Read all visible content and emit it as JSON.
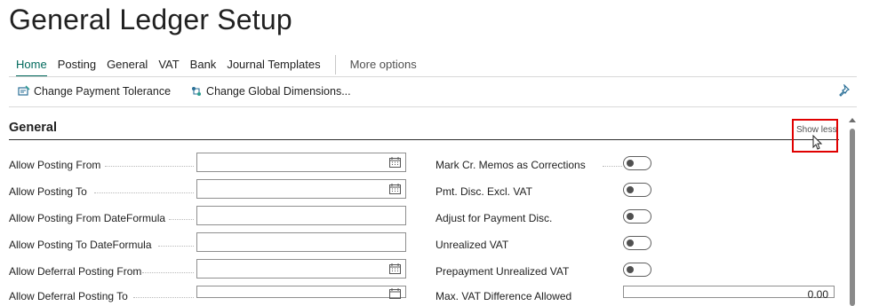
{
  "page": {
    "title": "General Ledger Setup"
  },
  "tabs": [
    {
      "label": "Home",
      "active": true
    },
    {
      "label": "Posting"
    },
    {
      "label": "General"
    },
    {
      "label": "VAT"
    },
    {
      "label": "Bank"
    },
    {
      "label": "Journal Templates"
    }
  ],
  "more_options": "More options",
  "actions": [
    {
      "label": "Change Payment Tolerance",
      "icon": "payment-tolerance-icon"
    },
    {
      "label": "Change Global Dimensions...",
      "icon": "global-dimensions-icon"
    }
  ],
  "pin_icon": "pin-icon",
  "section": {
    "title": "General",
    "toggle_label": "Show less"
  },
  "left_fields": [
    {
      "label": "Allow Posting From",
      "value": "",
      "calendar": true
    },
    {
      "label": "Allow Posting To",
      "value": "",
      "calendar": true
    },
    {
      "label": "Allow Posting From DateFormula",
      "value": "",
      "calendar": false
    },
    {
      "label": "Allow Posting To DateFormula",
      "value": "",
      "calendar": false
    },
    {
      "label": "Allow Deferral Posting From",
      "value": "",
      "calendar": true
    },
    {
      "label": "Allow Deferral Posting To",
      "value": "",
      "calendar": true
    }
  ],
  "right_fields": [
    {
      "label": "Mark Cr. Memos as Corrections",
      "type": "toggle",
      "on": false
    },
    {
      "label": "Pmt. Disc. Excl. VAT",
      "type": "toggle",
      "on": false
    },
    {
      "label": "Adjust for Payment Disc.",
      "type": "toggle",
      "on": false
    },
    {
      "label": "Unrealized VAT",
      "type": "toggle",
      "on": false
    },
    {
      "label": "Prepayment Unrealized VAT",
      "type": "toggle",
      "on": false
    },
    {
      "label": "Max. VAT Difference Allowed",
      "type": "number",
      "value": "0.00"
    }
  ],
  "colors": {
    "accent": "#00695c",
    "highlight": "#e00000",
    "text": "#212121"
  }
}
